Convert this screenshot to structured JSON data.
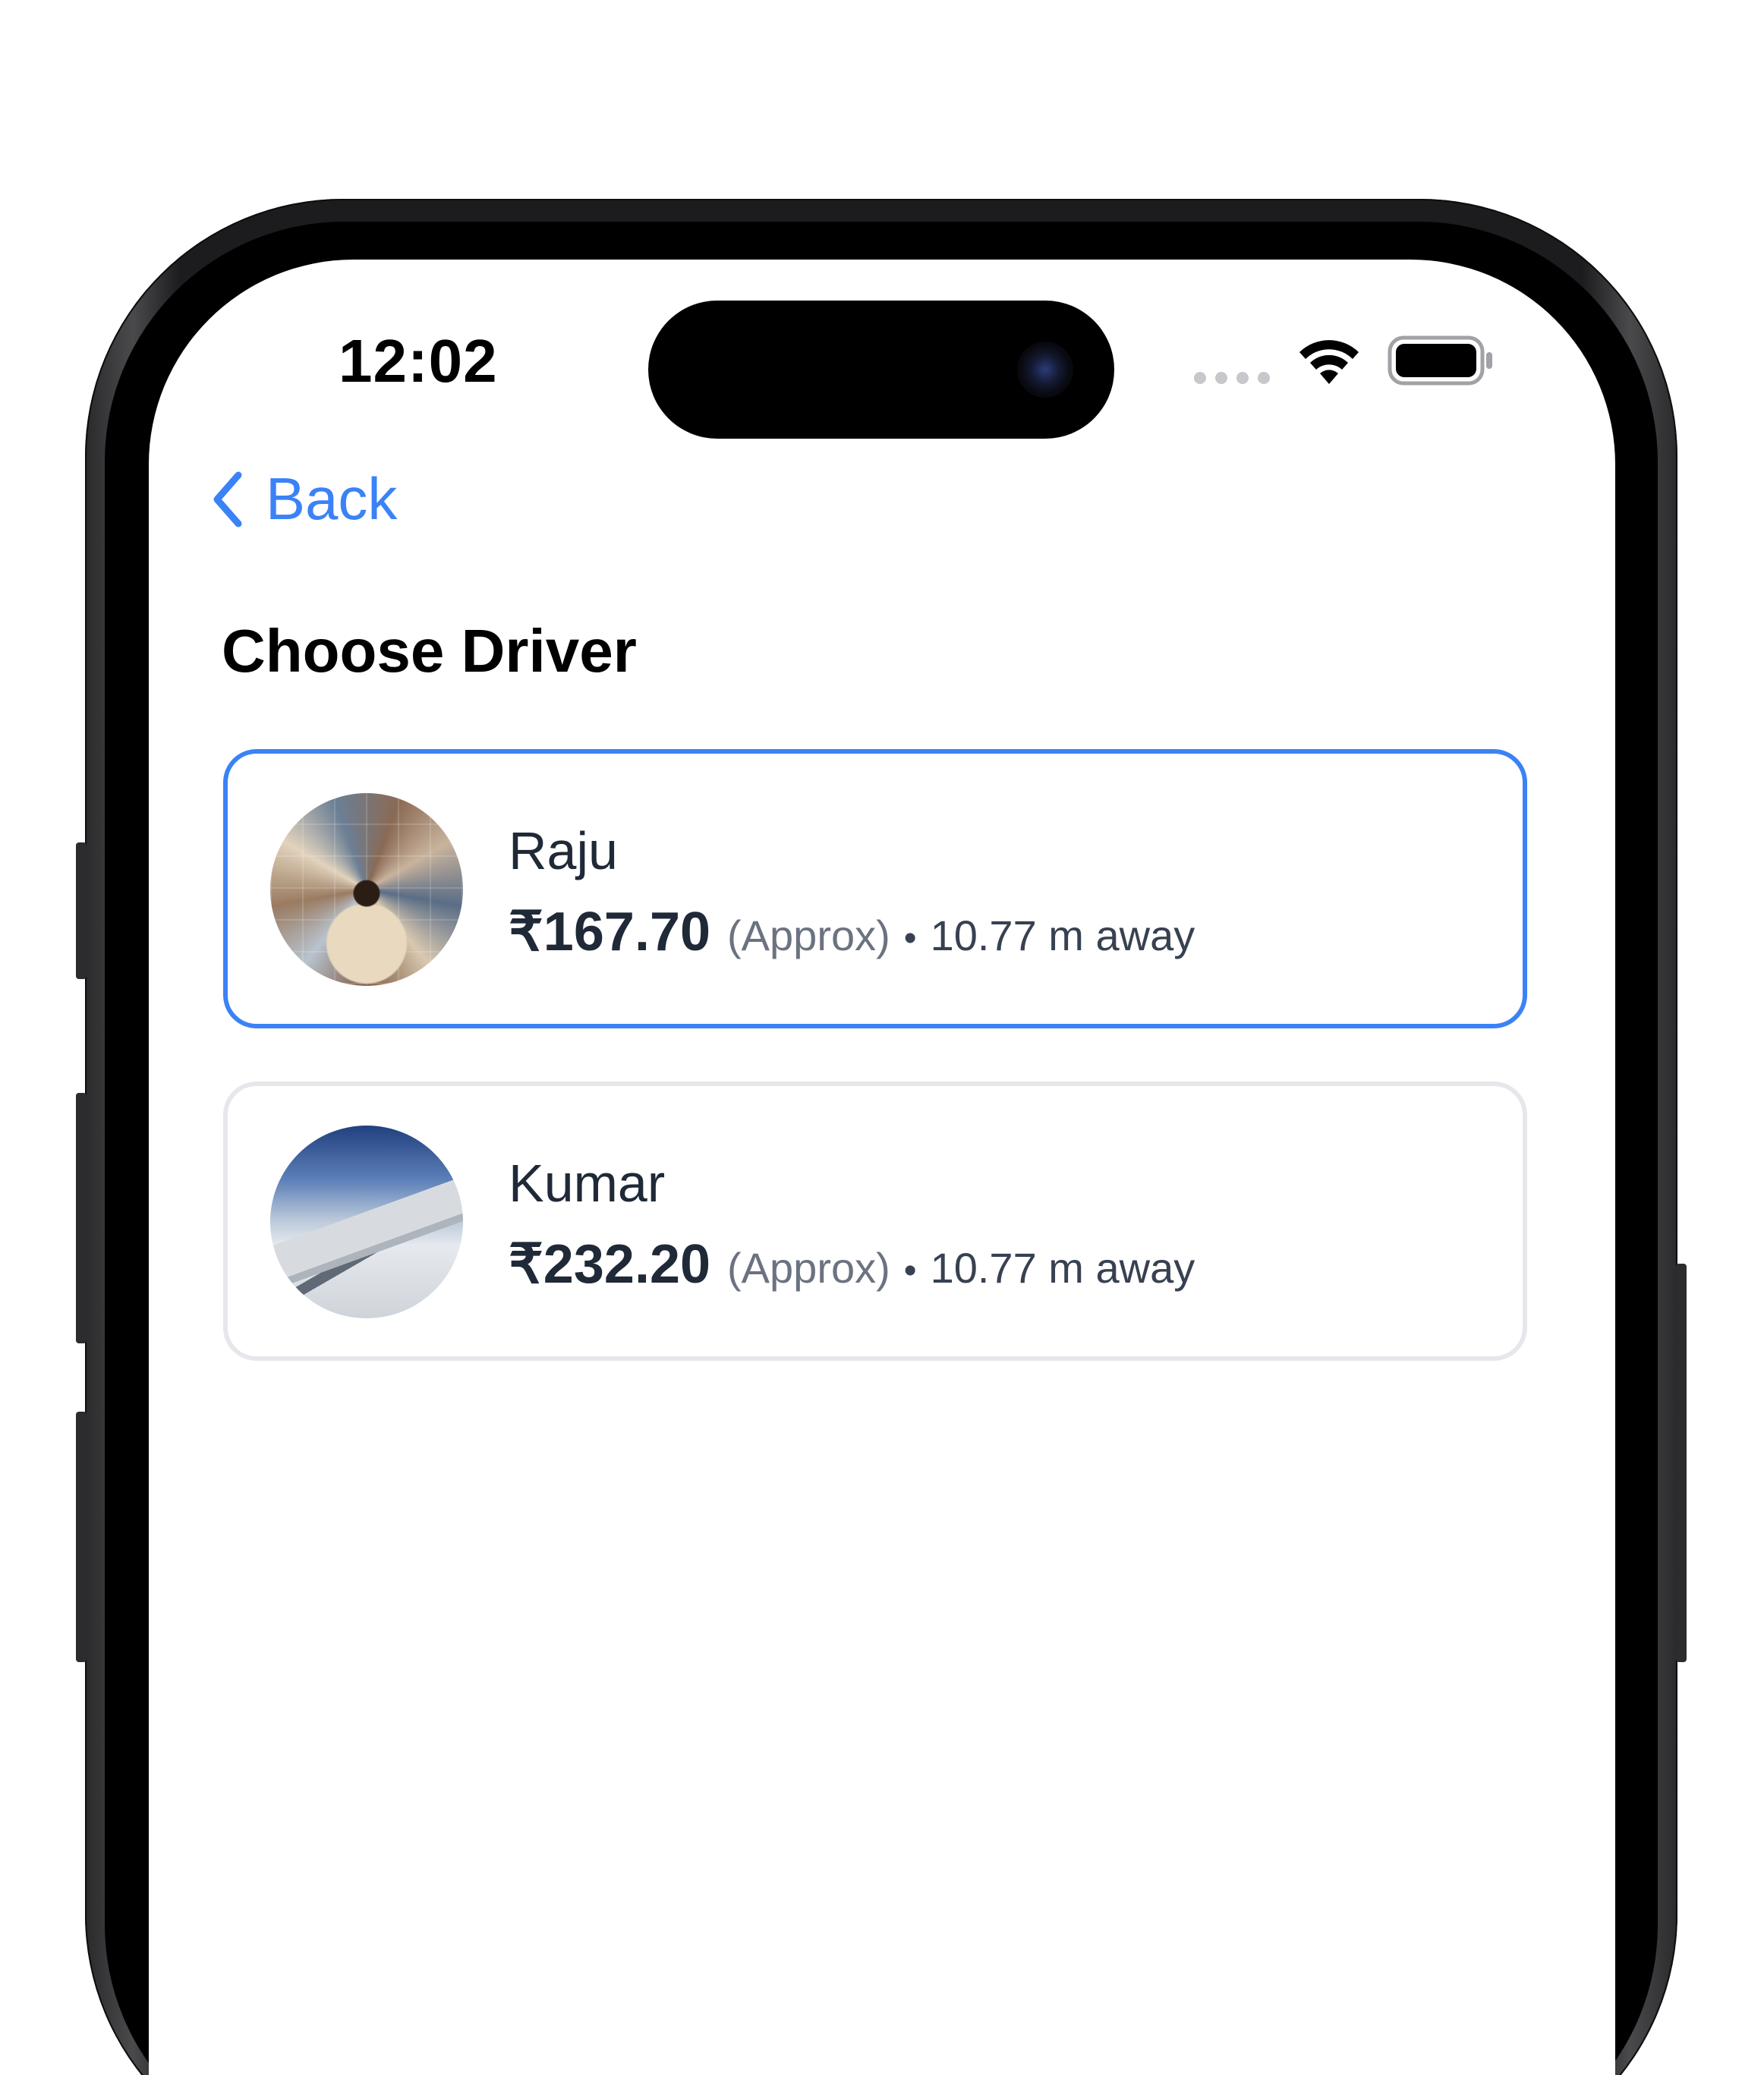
{
  "status_bar": {
    "time": "12:02"
  },
  "nav": {
    "back_label": "Back",
    "back_icon": "chevron-left-icon"
  },
  "page": {
    "title": "Choose Driver"
  },
  "drivers": [
    {
      "name": "Raju",
      "price": "₹167.70",
      "approx_label": "(Approx)",
      "separator": "•",
      "distance": "10.77 m away",
      "selected": true
    },
    {
      "name": "Kumar",
      "price": "₹232.20",
      "approx_label": "(Approx)",
      "separator": "•",
      "distance": "10.77 m away",
      "selected": false
    }
  ],
  "colors": {
    "accent": "#3b82f6",
    "card_border": "#e5e7eb",
    "text_primary": "#1f2937",
    "text_muted": "#6b7280"
  }
}
